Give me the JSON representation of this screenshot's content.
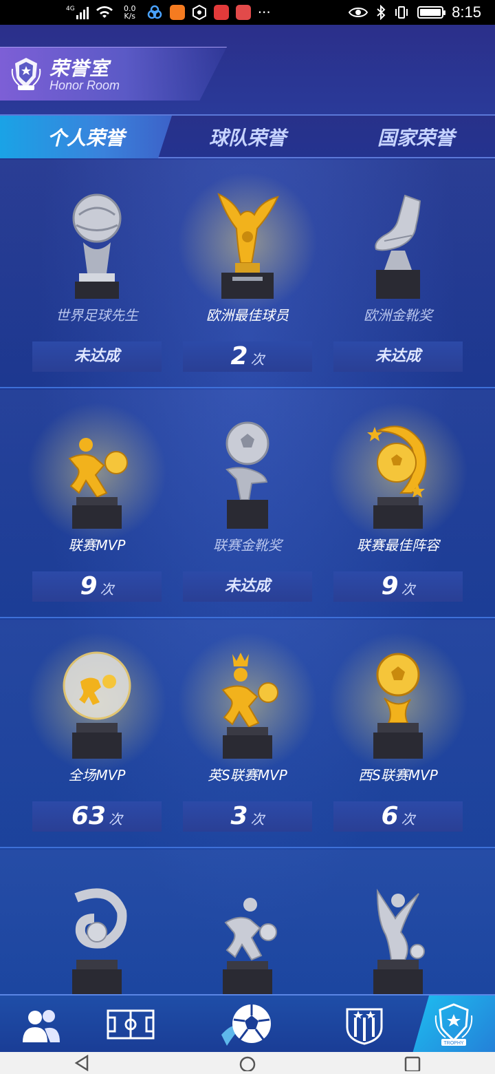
{
  "status_bar": {
    "network": "4G",
    "net_speed_value": "0.0",
    "net_speed_unit": "K/s",
    "time": "8:15",
    "more": "···"
  },
  "header": {
    "title_cn": "荣誉室",
    "title_en": "Honor Room"
  },
  "tabs": [
    {
      "label": "个人荣誉",
      "active": true
    },
    {
      "label": "球队荣誉",
      "active": false
    },
    {
      "label": "国家荣誉",
      "active": false
    }
  ],
  "awards": [
    {
      "name": "世界足球先生",
      "count_text": "未达成",
      "achieved": false,
      "tint": "silver"
    },
    {
      "name": "欧洲最佳球员",
      "count": "2",
      "unit": "次",
      "achieved": true,
      "tint": "gold"
    },
    {
      "name": "欧洲金靴奖",
      "count_text": "未达成",
      "achieved": false,
      "tint": "silver"
    },
    {
      "name": "联赛MVP",
      "count": "9",
      "unit": "次",
      "achieved": true,
      "tint": "gold"
    },
    {
      "name": "联赛金靴奖",
      "count_text": "未达成",
      "achieved": false,
      "tint": "silver"
    },
    {
      "name": "联赛最佳阵容",
      "count": "9",
      "unit": "次",
      "achieved": true,
      "tint": "gold"
    },
    {
      "name": "全场MVP",
      "count": "63",
      "unit": "次",
      "achieved": true,
      "tint": "gold"
    },
    {
      "name": "英S联赛MVP",
      "count": "3",
      "unit": "次",
      "achieved": true,
      "tint": "gold"
    },
    {
      "name": "西S联赛MVP",
      "count": "6",
      "unit": "次",
      "achieved": true,
      "tint": "gold"
    }
  ],
  "colors": {
    "gold": "#f2b21c",
    "silver": "#c9ccd6",
    "accent": "#1ea6ea"
  },
  "bottom_nav": [
    {
      "icon": "players-icon",
      "active": false
    },
    {
      "icon": "pitch-icon",
      "active": false
    },
    {
      "icon": "soccer-ball-icon",
      "active": false
    },
    {
      "icon": "club-crest-icon",
      "active": false
    },
    {
      "icon": "trophy-badge-icon",
      "label": "TROPHY",
      "active": true
    }
  ],
  "system_nav": [
    "back-icon",
    "home-icon",
    "recents-icon"
  ]
}
